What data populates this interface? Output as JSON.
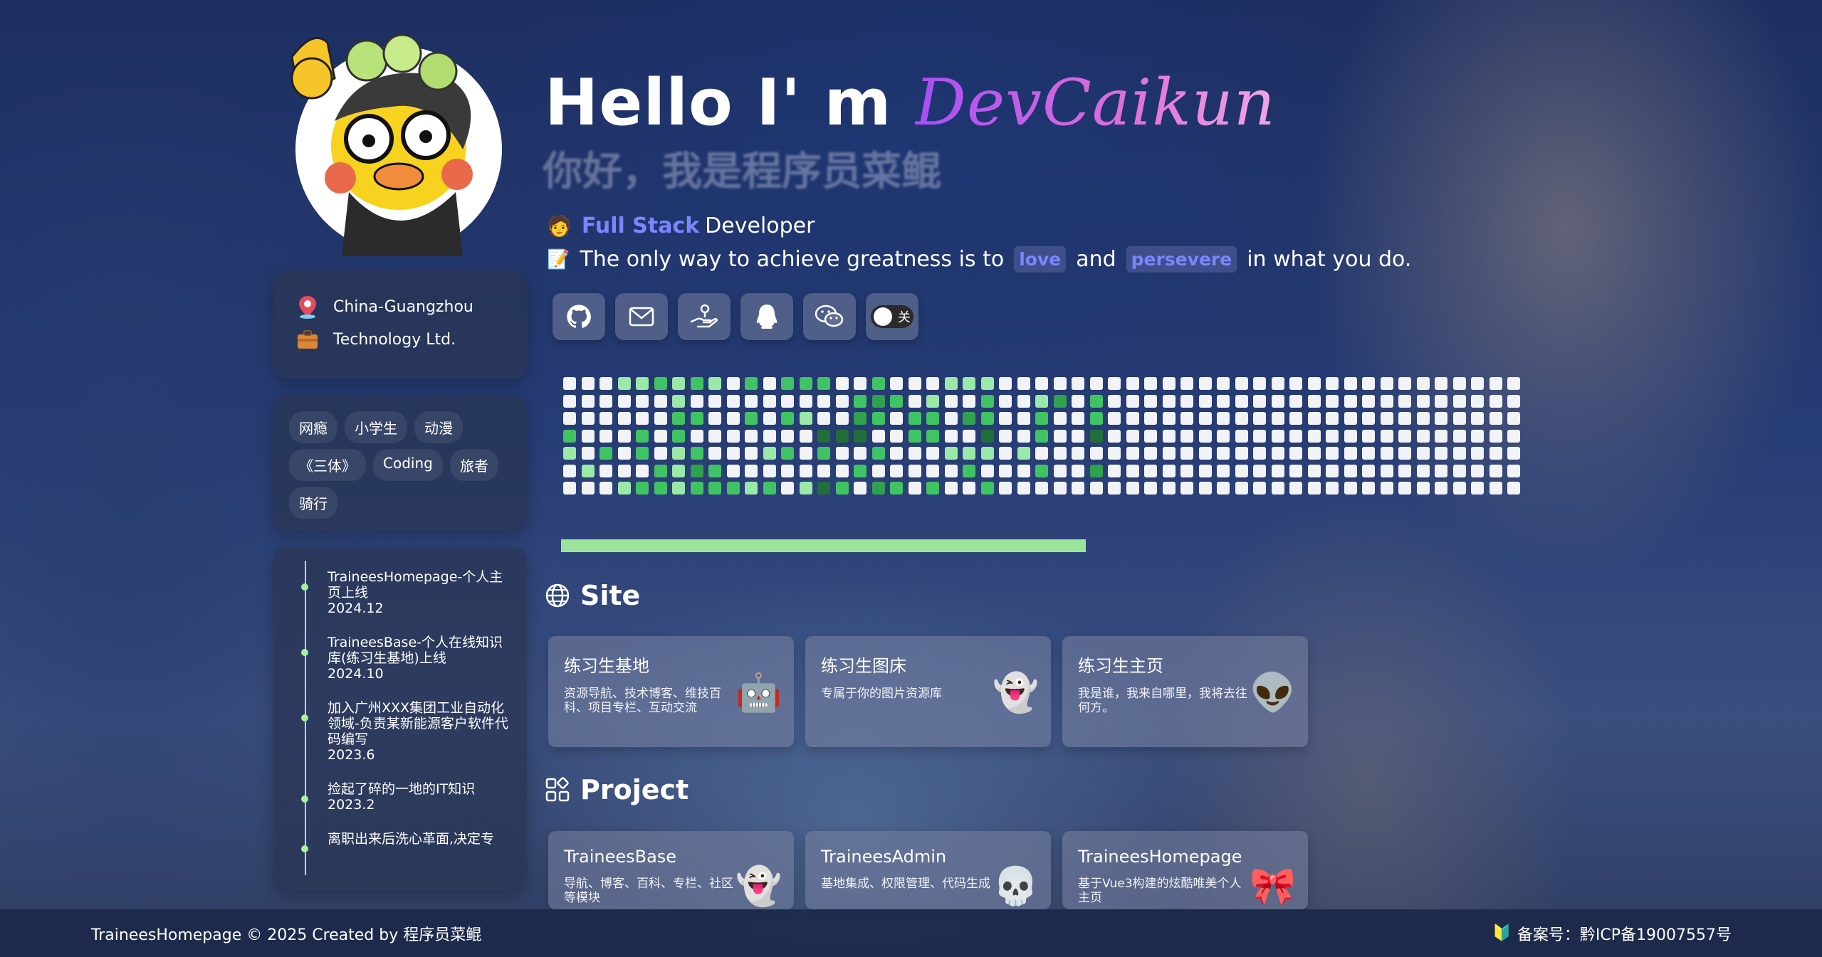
{
  "profile": {
    "location": "China-Guangzhou",
    "company": "Technology Ltd.",
    "tags": [
      "网瘾",
      "小学生",
      "动漫",
      "《三体》",
      "Coding",
      "旅者",
      "骑行"
    ]
  },
  "timeline": [
    {
      "title": "TraineesHomepage-个人主页上线",
      "date": "2024.12"
    },
    {
      "title": "TraineesBase-个人在线知识库(练习生基地)上线",
      "date": "2024.10"
    },
    {
      "title": "加入广州XXX集团工业自动化领域-负责某新能源客户软件代码编写",
      "date": "2023.6"
    },
    {
      "title": "捡起了碎的一地的IT知识",
      "date": "2023.2"
    },
    {
      "title": "离职出来后洗心革面,决定专",
      "date": ""
    }
  ],
  "hero": {
    "hello": "Hello I' m ",
    "name": "DevCaikun",
    "subtitle": "你好，我是程序员菜鲲",
    "role_highlight": "Full Stack",
    "role_rest": "Developer",
    "motto_part1": "The only way to achieve greatness is to",
    "motto_kw1": "love",
    "motto_and": "and",
    "motto_kw2": "persevere",
    "motto_part2": "in what you do."
  },
  "socials": [
    "github-icon",
    "mail-icon",
    "hand-gift-icon",
    "qq-penguin-icon",
    "wechat-icon"
  ],
  "toggle": {
    "label": "关",
    "on": false
  },
  "contributions": {
    "colors": [
      "#f2f3f7",
      "#9be9a8",
      "#40c463",
      "#30a14e",
      "#216e39"
    ],
    "levels": [
      "000112121020222002000111000000000000000000000000000000000000000000000000000000000000000000000000000000",
      "000000100000000023201002001302000000000000000000000000000000000000000000000000000000000000000000000000",
      "000000220020210032022032002002000000000000000000000000000000000000000000000000000000000000000000000000",
      "200020200000004440022004002004000000000000000000000000000000000000000000000000000000000000000000000000",
      "102020120001202002000111010000000000000000000000000000000000000000000000000000000000000000000000000000",
      "010002132000000020000020002003000000000000000000000000000000000000000000000000000000000000000000000000",
      "000122122212014203202002000000000000000000000000000000000000000000000000000000000000000000000000000000"
    ],
    "progress": 0.548
  },
  "site": {
    "title": "Site",
    "items": [
      {
        "title": "练习生基地",
        "desc": "资源导航、技术博客、维技百科、项目专栏、互动交流",
        "icon": "ghost-robot-icon",
        "glyph": "🤖"
      },
      {
        "title": "练习生图床",
        "desc": "专属于你的图片资源库",
        "icon": "yellow-ghost-icon",
        "glyph": "👻"
      },
      {
        "title": "练习生主页",
        "desc": "我是谁，我来自哪里，我将去往何方。",
        "icon": "alien-icon",
        "glyph": "👽"
      }
    ]
  },
  "project": {
    "title": "Project",
    "items": [
      {
        "title": "TraineesBase",
        "desc": "导航、博客、百科、专栏、社区等模块",
        "icon": "ghost-icon",
        "glyph": "👻"
      },
      {
        "title": "TraineesAdmin",
        "desc": "基地集成、权限管理、代码生成",
        "icon": "skull-icon",
        "glyph": "💀"
      },
      {
        "title": "TraineesHomepage",
        "desc": "基于Vue3构建的炫酷唯美个人主页",
        "icon": "bow-icon",
        "glyph": "🎀"
      }
    ]
  },
  "footer": {
    "copyright": "TraineesHomepage © 2025 Created by 程序员菜鲲",
    "icp": "备案号：黔ICP备19007557号"
  }
}
